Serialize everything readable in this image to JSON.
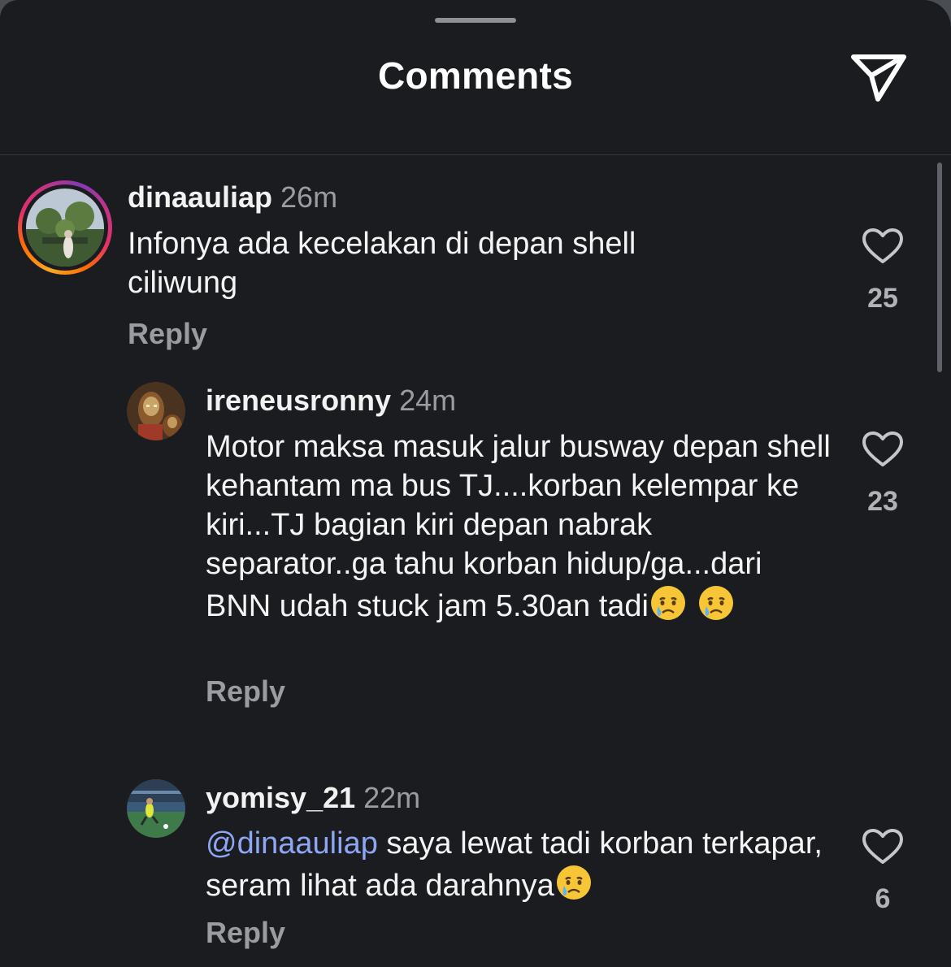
{
  "header": {
    "title": "Comments"
  },
  "comments": [
    {
      "username": "dinaauliap",
      "time": "26m",
      "text": "Infonya ada kecelakan di depan shell ciliwung",
      "reply_label": "Reply",
      "likes": "25"
    },
    {
      "username": "ireneusronny",
      "time": "24m",
      "text": "Motor maksa masuk jalur busway depan shell kehantam ma bus TJ....korban kelempar ke kiri...TJ bagian kiri depan nabrak separator..ga tahu korban hidup/ga...dari BNN udah stuck jam 5.30an tadi",
      "reply_label": "Reply",
      "likes": "23"
    },
    {
      "username": "yomisy_21",
      "time": "22m",
      "mention": "@dinaauliap",
      "text": " saya lewat tadi korban terkapar, seram lihat ada darahnya",
      "reply_label": "Reply",
      "likes": "6"
    }
  ],
  "icons": {
    "share": "paper-plane-icon",
    "like": "heart-outline-icon",
    "emoji": "crying-face-emoji"
  },
  "colors": {
    "background": "#1a1c20",
    "mention": "#8fa6f2",
    "muted_text": "#9a9ca1"
  }
}
